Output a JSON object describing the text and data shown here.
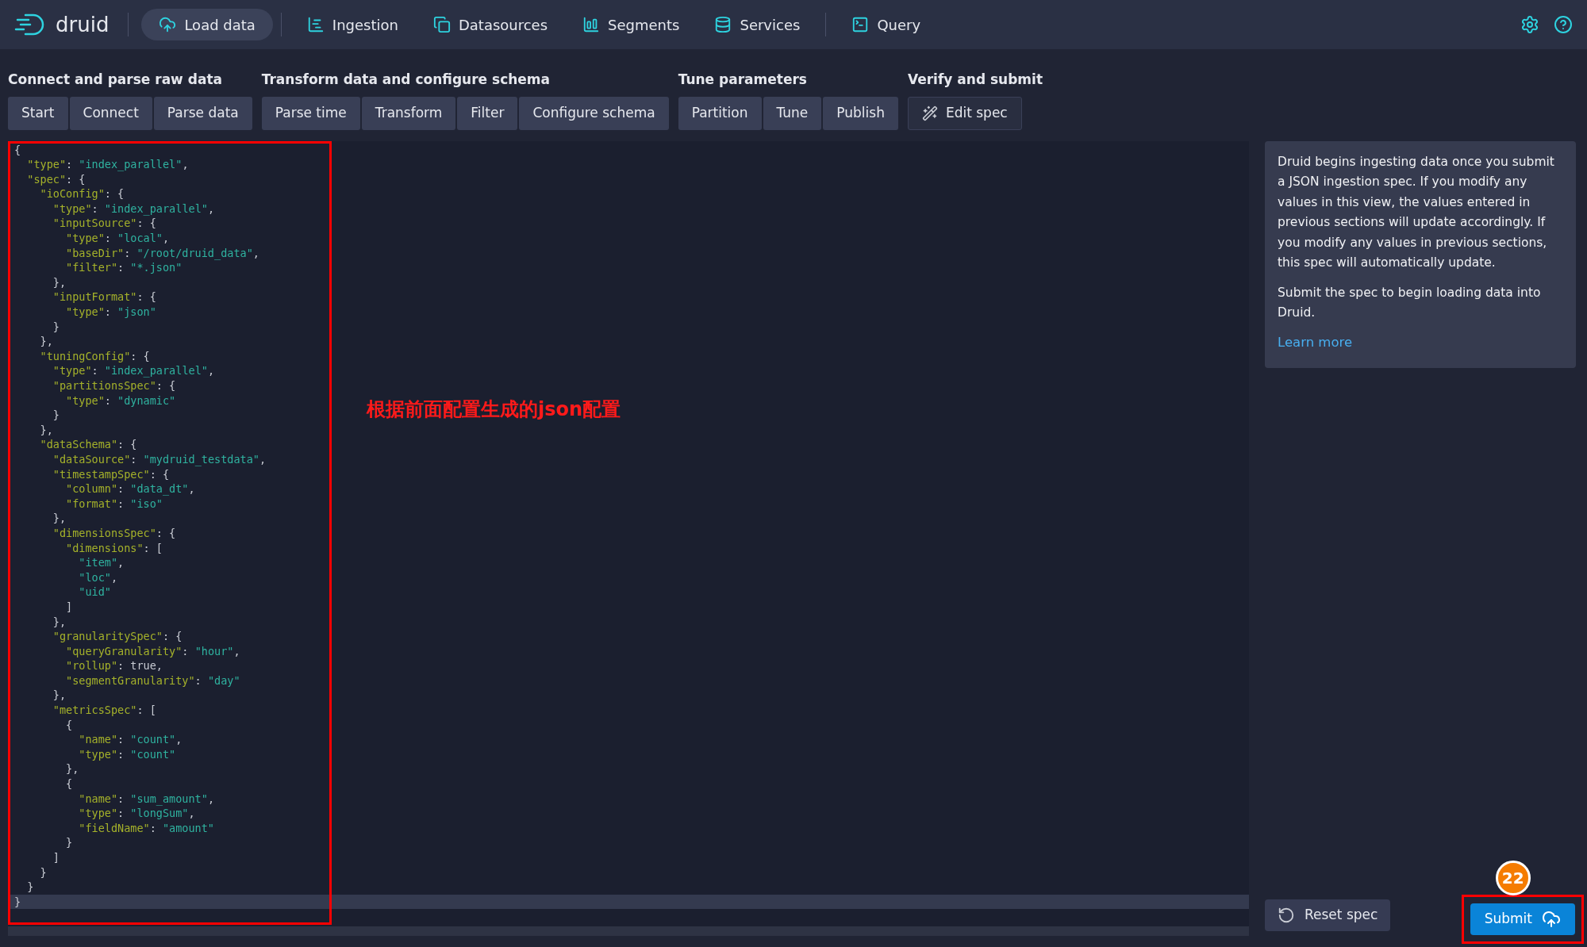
{
  "header": {
    "logo": "druid",
    "nav": [
      {
        "label": "Load data",
        "selected": true
      },
      {
        "label": "Ingestion",
        "selected": false
      },
      {
        "label": "Datasources",
        "selected": false
      },
      {
        "label": "Segments",
        "selected": false
      },
      {
        "label": "Services",
        "selected": false
      },
      {
        "label": "Query",
        "selected": false
      }
    ]
  },
  "step_groups": [
    {
      "title": "Connect and parse raw data",
      "steps": [
        {
          "label": "Start",
          "selected": false
        },
        {
          "label": "Connect",
          "selected": false
        },
        {
          "label": "Parse data",
          "selected": false
        }
      ]
    },
    {
      "title": "Transform data and configure schema",
      "steps": [
        {
          "label": "Parse time",
          "selected": false
        },
        {
          "label": "Transform",
          "selected": false
        },
        {
          "label": "Filter",
          "selected": false
        },
        {
          "label": "Configure schema",
          "selected": false
        }
      ]
    },
    {
      "title": "Tune parameters",
      "steps": [
        {
          "label": "Partition",
          "selected": false
        },
        {
          "label": "Tune",
          "selected": false
        },
        {
          "label": "Publish",
          "selected": false
        }
      ]
    },
    {
      "title": "Verify and submit",
      "steps": [
        {
          "label": "Edit spec",
          "selected": true
        }
      ]
    }
  ],
  "editor": {
    "lines": [
      "{",
      "  \"type\": \"index_parallel\",",
      "  \"spec\": {",
      "    \"ioConfig\": {",
      "      \"type\": \"index_parallel\",",
      "      \"inputSource\": {",
      "        \"type\": \"local\",",
      "        \"baseDir\": \"/root/druid_data\",",
      "        \"filter\": \"*.json\"",
      "      },",
      "      \"inputFormat\": {",
      "        \"type\": \"json\"",
      "      }",
      "    },",
      "    \"tuningConfig\": {",
      "      \"type\": \"index_parallel\",",
      "      \"partitionsSpec\": {",
      "        \"type\": \"dynamic\"",
      "      }",
      "    },",
      "    \"dataSchema\": {",
      "      \"dataSource\": \"mydruid_testdata\",",
      "      \"timestampSpec\": {",
      "        \"column\": \"data_dt\",",
      "        \"format\": \"iso\"",
      "      },",
      "      \"dimensionsSpec\": {",
      "        \"dimensions\": [",
      "          \"item\",",
      "          \"loc\",",
      "          \"uid\"",
      "        ]",
      "      },",
      "      \"granularitySpec\": {",
      "        \"queryGranularity\": \"hour\",",
      "        \"rollup\": true,",
      "        \"segmentGranularity\": \"day\"",
      "      },",
      "      \"metricsSpec\": [",
      "        {",
      "          \"name\": \"count\",",
      "          \"type\": \"count\"",
      "        },",
      "        {",
      "          \"name\": \"sum_amount\",",
      "          \"type\": \"longSum\",",
      "          \"fieldName\": \"amount\"",
      "        }",
      "      ]",
      "    }",
      "  }",
      "}"
    ]
  },
  "info": {
    "paragraphs": [
      "Druid begins ingesting data once you submit a JSON ingestion spec. If you modify any values in this view, the values entered in previous sections will update accordingly. If you modify any values in previous sections, this spec will automatically update.",
      "Submit the spec to begin loading data into Druid."
    ],
    "link": "Learn more"
  },
  "actions": {
    "reset": "Reset spec",
    "submit": "Submit"
  },
  "annotations": {
    "note": "根据前面配置生成的json配置",
    "badge": "22"
  }
}
